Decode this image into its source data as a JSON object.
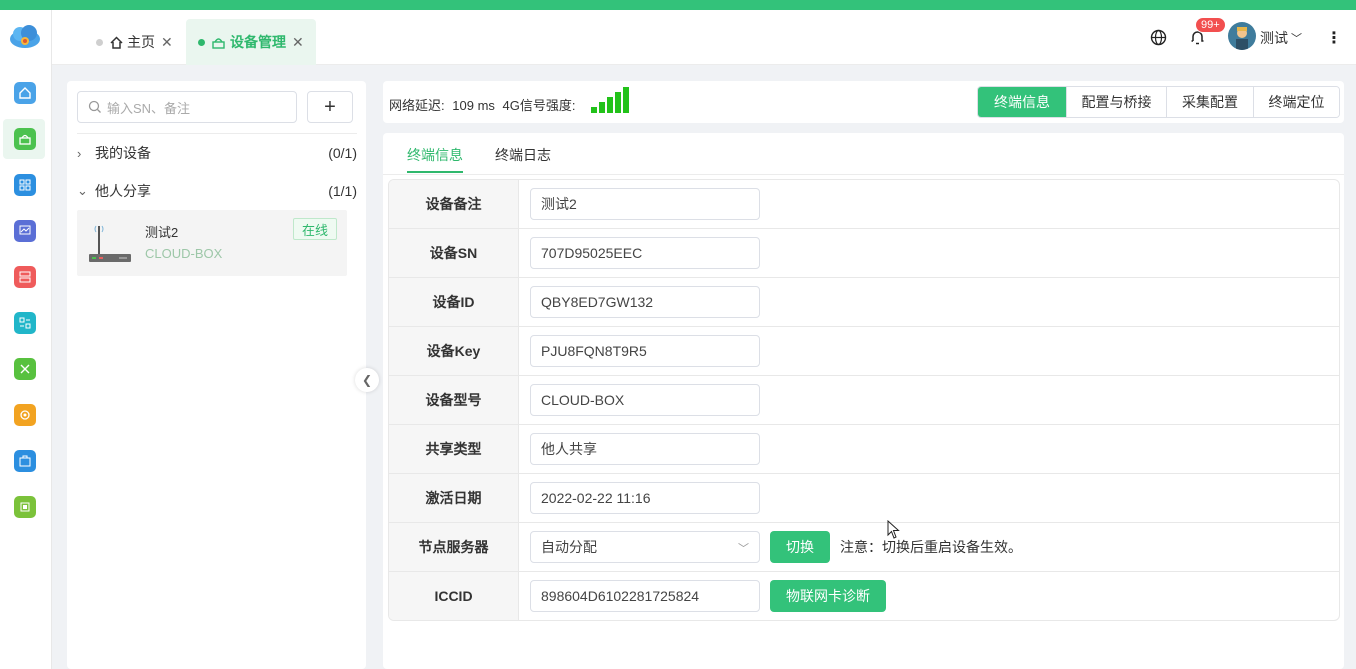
{
  "header": {
    "tabs": [
      {
        "label": "主页"
      },
      {
        "label": "设备管理"
      }
    ],
    "notification_count": "99+",
    "user_name": "测试"
  },
  "left_panel": {
    "search_placeholder": "输入SN、备注",
    "add_label": "+",
    "groups": [
      {
        "label": "我的设备",
        "count": "(0/1)"
      },
      {
        "label": "他人分享",
        "count": "(1/1)"
      }
    ],
    "device": {
      "name": "测试2",
      "model": "CLOUD-BOX",
      "status": "在线"
    }
  },
  "status_bar": {
    "latency_label": "网络延迟:",
    "latency_value": "109",
    "latency_unit": "ms",
    "signal_label": "4G信号强度:",
    "signal_bars": 5,
    "buttons": [
      "终端信息",
      "配置与桥接",
      "采集配置",
      "终端定位"
    ],
    "active_button": "终端信息"
  },
  "main": {
    "subtabs": [
      "终端信息",
      "终端日志"
    ],
    "fields": [
      {
        "label": "设备备注",
        "value": "测试2"
      },
      {
        "label": "设备SN",
        "value": "707D95025EEC"
      },
      {
        "label": "设备ID",
        "value": "QBY8ED7GW132"
      },
      {
        "label": "设备Key",
        "value": "PJU8FQN8T9R5"
      },
      {
        "label": "设备型号",
        "value": "CLOUD-BOX"
      },
      {
        "label": "共享类型",
        "value": "他人共享"
      },
      {
        "label": "激活日期",
        "value": "2022-02-22 11:16"
      },
      {
        "label": "节点服务器",
        "value": "自动分配",
        "button": "切换",
        "note": "注意：切换后重启设备生效。"
      },
      {
        "label": "ICCID",
        "value": "898604D6102281725824",
        "button": "物联网卡诊断"
      }
    ]
  },
  "colors": {
    "accent": "#33c27a",
    "badge": "#f24f4f"
  }
}
